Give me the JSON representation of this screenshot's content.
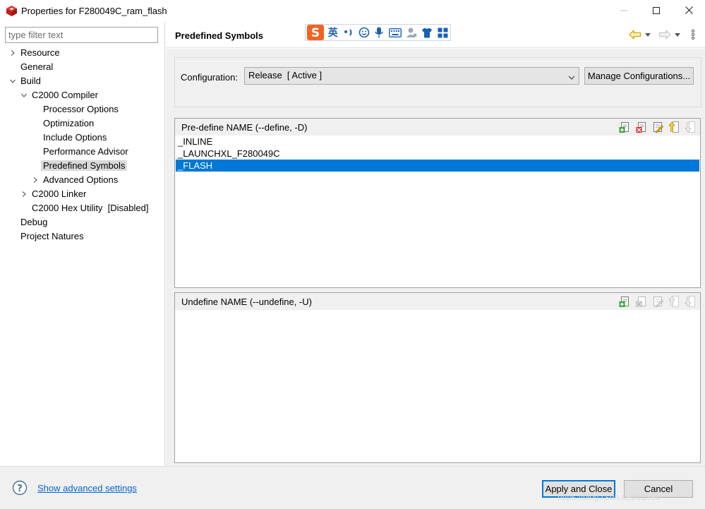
{
  "window": {
    "title": "Properties for F280049C_ram_flash",
    "app_icon": "ccs-cube-icon",
    "controls": [
      "minimize-icon",
      "maximize-icon",
      "close-icon"
    ]
  },
  "filter": {
    "placeholder": "type filter text",
    "value": ""
  },
  "tree": {
    "items": [
      {
        "label": "Resource",
        "expander": "collapsed"
      },
      {
        "label": "General",
        "expander": "none"
      },
      {
        "label": "Build",
        "expander": "expanded"
      },
      {
        "label": "C2000 Compiler",
        "expander": "expanded"
      },
      {
        "label": "Processor Options",
        "expander": "none"
      },
      {
        "label": "Optimization",
        "expander": "none"
      },
      {
        "label": "Include Options",
        "expander": "none"
      },
      {
        "label": "Performance Advisor",
        "expander": "none"
      },
      {
        "label": "Predefined Symbols",
        "expander": "none",
        "selected": true
      },
      {
        "label": "Advanced Options",
        "expander": "collapsed"
      },
      {
        "label": "C2000 Linker",
        "expander": "collapsed"
      },
      {
        "label": "C2000 Hex Utility  [Disabled]",
        "expander": "none"
      },
      {
        "label": "Debug",
        "expander": "none"
      },
      {
        "label": "Project Natures",
        "expander": "none"
      }
    ]
  },
  "page": {
    "title": "Predefined Symbols",
    "ime_toolbar": {
      "logo": "sogou-s-icon",
      "mode": "英",
      "icons": [
        "punctuation-icon",
        "emoji-icon",
        "microphone-icon",
        "keyboard-icon",
        "user-icon",
        "skin-shirt-icon",
        "grid-icon"
      ]
    },
    "nav_icons": [
      "back-arrow-icon",
      "back-menu-icon",
      "forward-arrow-icon",
      "forward-menu-icon",
      "view-menu-icon"
    ]
  },
  "configuration": {
    "label": "Configuration:",
    "selected": "Release  [ Active ]",
    "manage_label": "Manage Configurations..."
  },
  "predefine": {
    "header": "Pre-define NAME (--define, -D)",
    "items": [
      "_INLINE",
      "_LAUNCHXL_F280049C",
      "_FLASH"
    ],
    "selected_index": 2,
    "tools": [
      "add-icon",
      "delete-icon",
      "edit-icon",
      "move-up-icon",
      "move-down-icon"
    ]
  },
  "undefine": {
    "header": "Undefine NAME (--undefine, -U)",
    "items": [],
    "tools": [
      "add-icon",
      "delete-icon",
      "edit-icon",
      "move-up-icon",
      "move-down-icon"
    ]
  },
  "footer": {
    "help_icon": "help-icon",
    "advanced_link": "Show advanced settings",
    "apply_label": "Apply and Close",
    "cancel_label": "Cancel"
  },
  "watermark": "https://blog.csdn.net/lz1996",
  "colors": {
    "selection": "#0078d7",
    "tree_selection": "#d9d9d9",
    "panel_bg": "#f0f0f0",
    "link": "#0066cc",
    "focus_border": "#0078d7"
  }
}
